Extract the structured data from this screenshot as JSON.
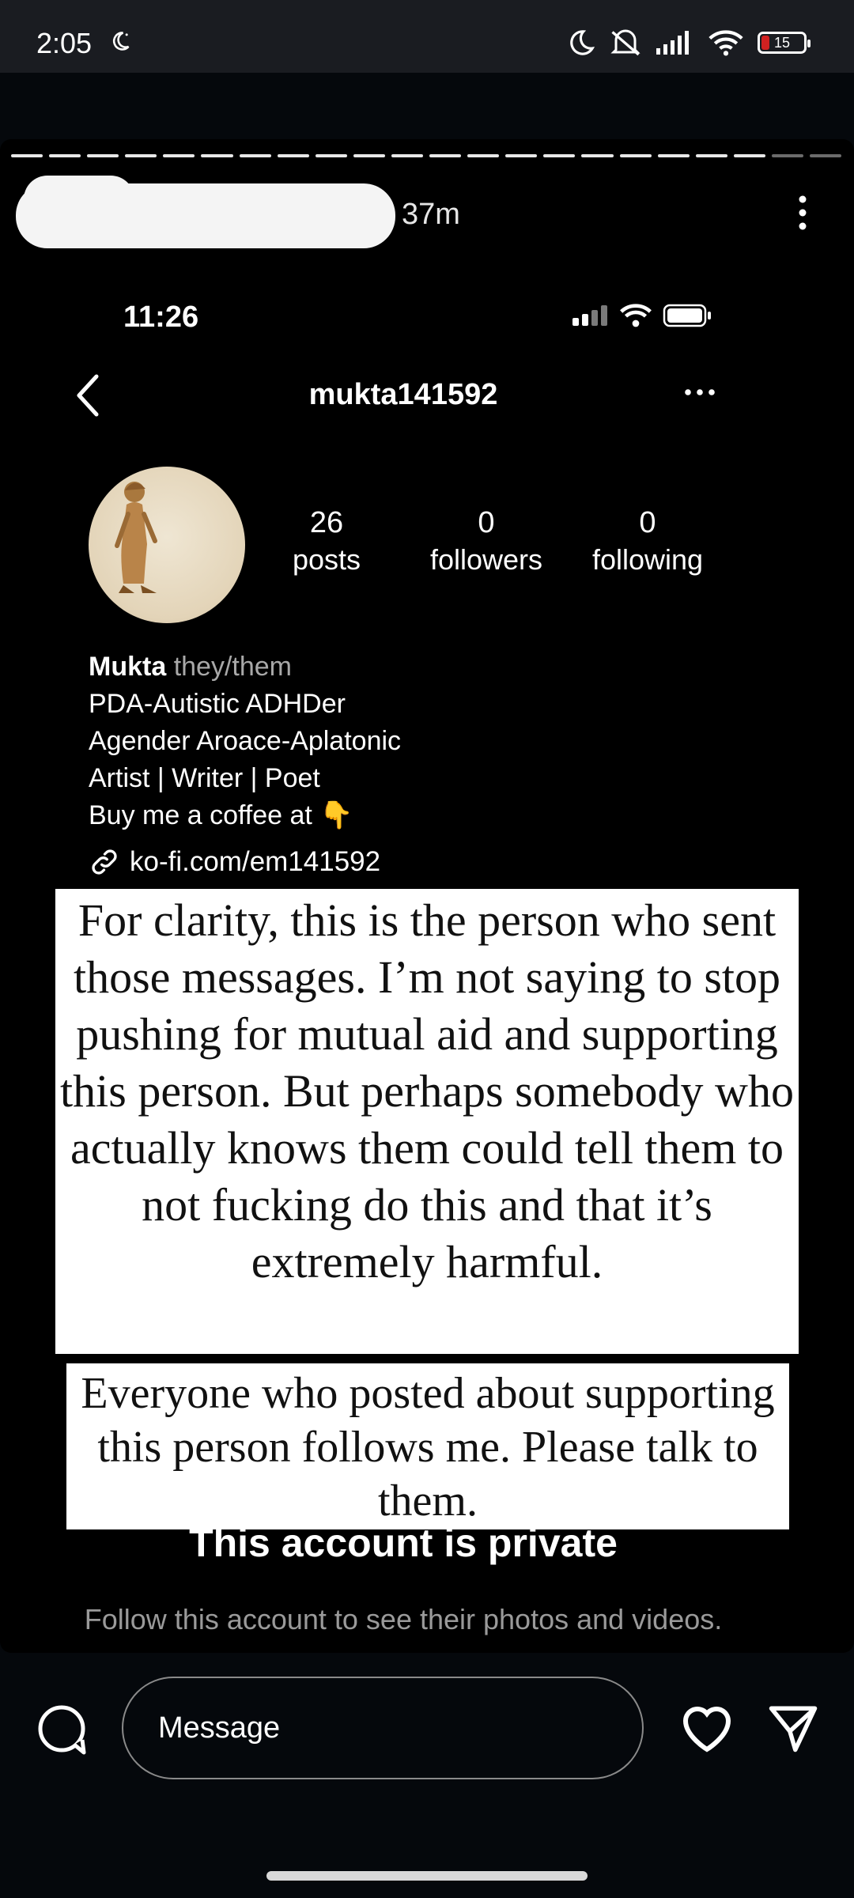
{
  "status_bar": {
    "time": "2:05",
    "battery": "15"
  },
  "story": {
    "progress_segments": 22,
    "progress_done": 20,
    "time_ago": "37m"
  },
  "inner_screenshot": {
    "time": "11:26",
    "username": "mukta141592",
    "stats": [
      {
        "num": "26",
        "label": "posts"
      },
      {
        "num": "0",
        "label": "followers"
      },
      {
        "num": "0",
        "label": "following"
      }
    ],
    "bio": {
      "name": "Mukta",
      "pronouns": "they/them",
      "line1": "PDA-Autistic ADHDer",
      "line2": "Agender Aroace-Aplatonic",
      "line3": "Artist | Writer | Poet",
      "line4": "Buy me a coffee at",
      "emoji": "👇",
      "link": "ko-fi.com/em141592"
    },
    "private_title": "This account is private",
    "private_sub": "Follow this account to see their photos and videos."
  },
  "captions": {
    "caption1": "For clarity, this is the person who sent those messages. I’m not saying to stop pushing for mutual aid and supporting this person. But perhaps somebody who actually knows them could tell them to not fucking do this and that it’s extremely harmful.",
    "caption2": "Everyone who posted about supporting this person follows me. Please talk to them."
  },
  "bottom_bar": {
    "message_placeholder": "Message"
  },
  "colors": {
    "battery_low": "#d12121",
    "caption_bg": "#ffffff"
  },
  "icons": [
    "moon-icon",
    "mute-icon",
    "signal-icon",
    "wifi-icon",
    "battery-icon",
    "more-vertical-icon",
    "back-arrow-icon",
    "more-horizontal-icon",
    "link-icon",
    "camera-icon",
    "heart-icon",
    "send-icon"
  ]
}
